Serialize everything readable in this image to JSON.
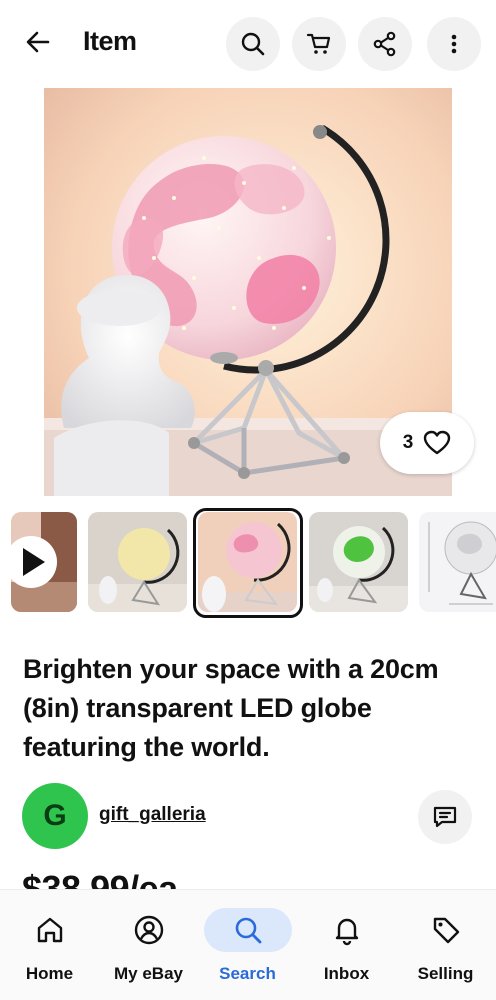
{
  "header": {
    "title": "Item"
  },
  "listing": {
    "watch_count": "3",
    "title": "Brighten your space with a 20cm (8in) transparent LED globe featuring the world.",
    "price": "$38.99/ea"
  },
  "seller": {
    "initial": "G",
    "name": "gift_galleria",
    "avatar_color": "#2fc44e"
  },
  "nav": {
    "items": [
      {
        "label": "Home",
        "icon": "home-icon"
      },
      {
        "label": "My eBay",
        "icon": "account-icon"
      },
      {
        "label": "Search",
        "icon": "search-icon",
        "active": true
      },
      {
        "label": "Inbox",
        "icon": "bell-icon"
      },
      {
        "label": "Selling",
        "icon": "tag-icon"
      }
    ]
  },
  "colors": {
    "accent": "#2b6ad9",
    "active_nav_bg": "#dbe7fb"
  }
}
